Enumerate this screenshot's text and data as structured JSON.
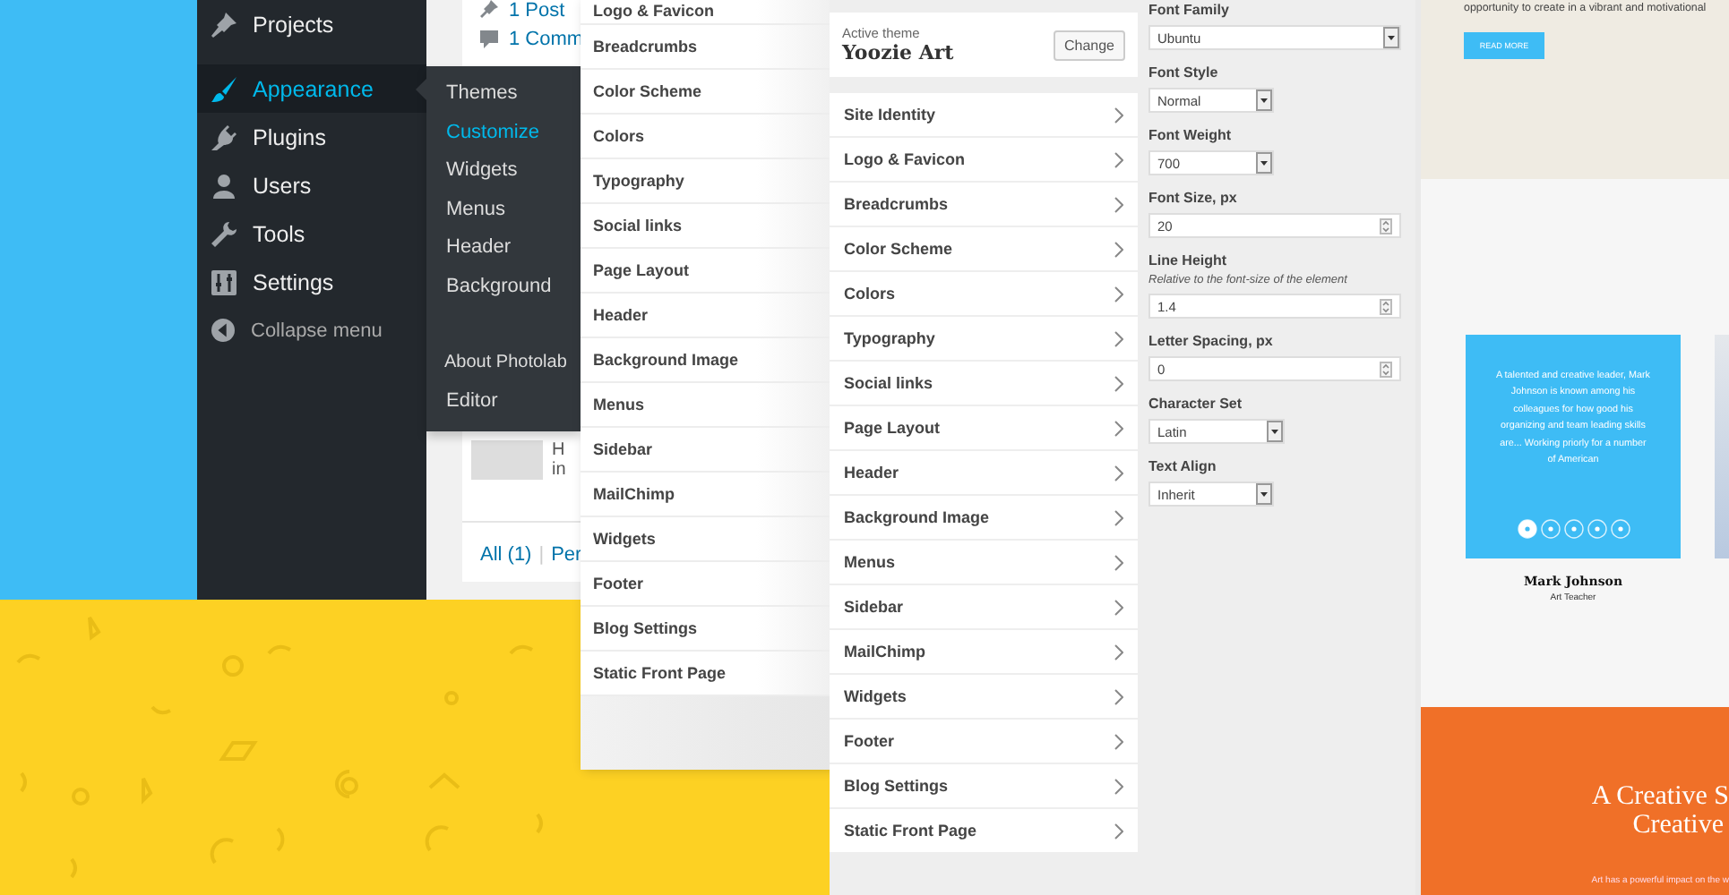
{
  "admin_menu": {
    "items": [
      {
        "label": "Projects",
        "selected": false
      },
      {
        "label": "Appearance",
        "selected": true
      },
      {
        "label": "Plugins",
        "selected": false
      },
      {
        "label": "Users",
        "selected": false
      },
      {
        "label": "Tools",
        "selected": false
      },
      {
        "label": "Settings",
        "selected": false
      },
      {
        "label": "Collapse menu",
        "selected": false
      }
    ],
    "submenu": [
      {
        "label": "Themes",
        "selected": false
      },
      {
        "label": "Customize",
        "selected": true
      },
      {
        "label": "Widgets",
        "selected": false
      },
      {
        "label": "Menus",
        "selected": false
      },
      {
        "label": "Header",
        "selected": false
      },
      {
        "label": "Background",
        "selected": false
      },
      {
        "label": "About Photolab",
        "selected": false
      },
      {
        "label": "Editor",
        "selected": false
      }
    ]
  },
  "dashboard": {
    "stats": [
      "1 Post",
      "1 Comm"
    ],
    "comment_excerpt": [
      "H",
      "in"
    ],
    "filters": [
      "All (1)",
      "|",
      "Per"
    ]
  },
  "customizer_back": {
    "sections": [
      "Logo & Favicon",
      "Breadcrumbs",
      "Color Scheme",
      "Colors",
      "Typography",
      "Social links",
      "Page Layout",
      "Header",
      "Background Image",
      "Menus",
      "Sidebar",
      "MailChimp",
      "Widgets",
      "Footer",
      "Blog Settings",
      "Static Front Page"
    ]
  },
  "customizer": {
    "active_theme_label": "Active theme",
    "theme_name": "Yoozie Art",
    "change_button": "Change",
    "sections": [
      "Site Identity",
      "Logo & Favicon",
      "Breadcrumbs",
      "Color Scheme",
      "Colors",
      "Typography",
      "Social links",
      "Page Layout",
      "Header",
      "Background Image",
      "Menus",
      "Sidebar",
      "MailChimp",
      "Widgets",
      "Footer",
      "Blog Settings",
      "Static Front Page"
    ]
  },
  "typography": {
    "fields": [
      {
        "kind": "select",
        "label": "Font Family",
        "value": "Ubuntu"
      },
      {
        "kind": "select",
        "label": "Font Style",
        "value": "Normal"
      },
      {
        "kind": "select",
        "label": "Font Weight",
        "value": "700"
      },
      {
        "kind": "number",
        "label": "Font Size, px",
        "value": "20"
      },
      {
        "kind": "number",
        "label": "Line Height",
        "description": "Relative to the font-size of the element",
        "value": "1.4"
      },
      {
        "kind": "number",
        "label": "Letter Spacing, px",
        "value": "0"
      },
      {
        "kind": "select",
        "label": "Character Set",
        "value": "Latin"
      },
      {
        "kind": "select",
        "label": "Text Align",
        "value": "Inherit"
      }
    ]
  },
  "preview": {
    "intro": "opportunity to create in a vibrant and motivational",
    "read_more": "READ MORE",
    "team_card": {
      "bio": "A talented and creative leader, Mark Johnson is known among his colleagues for how good his organizing and team leading skills are... Working priorly for a number of American",
      "social_links": [
        {
          "selected": true
        },
        {
          "selected": false
        },
        {
          "selected": false
        },
        {
          "selected": false
        },
        {
          "selected": false
        }
      ],
      "name": "Mark Johnson",
      "role": "Art Teacher"
    },
    "banner": {
      "heading_lines": [
        "A Creative S",
        "Creative"
      ],
      "text": "Art has a powerful impact on the w"
    }
  }
}
